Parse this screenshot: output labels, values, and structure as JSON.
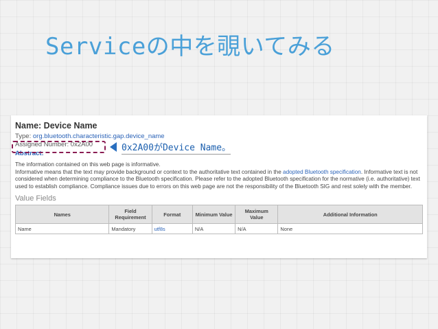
{
  "slide": {
    "title": "Serviceの中を覗いてみる",
    "callout": "0x2A00がDevice Name。"
  },
  "doc": {
    "title": "Name: Device Name",
    "type_label": "Type:",
    "type_value": "org.bluetooth.characteristic.gap.device_name",
    "assigned_number": "Assigned Number: 0x2A00",
    "abstract": "Abstract:",
    "para1": "The information contained on this web page is informative.",
    "para2a": "Informative means that the text may provide background or context to the authoritative text contained in the ",
    "para2_link": "adopted Bluetooth specification",
    "para2b": ". Informative text is not considered when determining compliance to the Bluetooth specification. Please refer to the adopted Bluetooth specification for the normative (i.e. authoritative) text used to establish compliance. Compliance issues due to errors on this web page are not the responsibility of the Bluetooth SIG and rest solely with the member.",
    "value_fields": "Value Fields",
    "table": {
      "headers": [
        "Names",
        "Field Requirement",
        "Format",
        "Minimum Value",
        "Maximum Value",
        "Additional Information"
      ],
      "row": [
        "Name",
        "Mandatory",
        "utf8s",
        "N/A",
        "N/A",
        "None"
      ]
    }
  },
  "colors": {
    "title": "#4aa0d8",
    "highlight_box": "#8a1c52",
    "arrow": "#2a6fbf",
    "link": "#2a62b7"
  },
  "icons": {
    "callout_arrow": "left-pointing-triangle-icon"
  }
}
